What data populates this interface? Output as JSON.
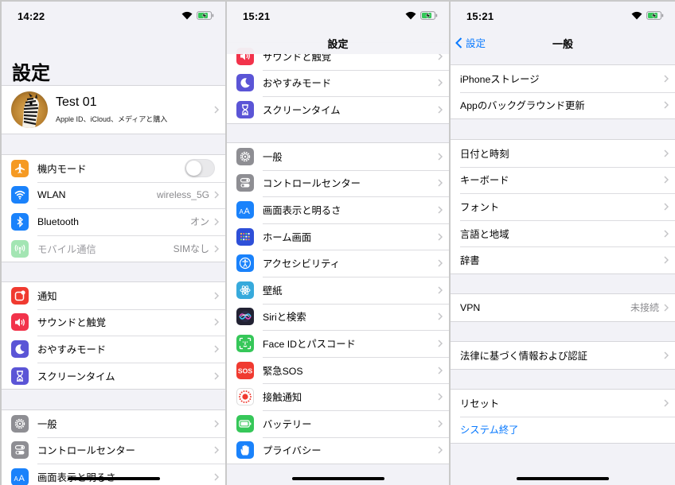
{
  "colors": {
    "accent": "#0a7aff",
    "background": "#f2f2f7"
  },
  "screen1": {
    "time": "14:22",
    "title": "設定",
    "profile": {
      "name": "Test 01",
      "subtitle": "Apple ID、iCloud、メディアと購入"
    },
    "group_connectivity": [
      {
        "label": "機内モード",
        "icon": "airplane-icon",
        "color": "#f59a23",
        "toggle": "off"
      },
      {
        "label": "WLAN",
        "icon": "wifi-icon",
        "color": "#1a82fb",
        "value": "wireless_5G"
      },
      {
        "label": "Bluetooth",
        "icon": "bluetooth-icon",
        "color": "#1a82fb",
        "value": "オン"
      },
      {
        "label": "モバイル通信",
        "icon": "antenna-icon",
        "color": "#36c759",
        "value": "SIMなし",
        "disabled": true
      }
    ],
    "group_notify": [
      {
        "label": "通知",
        "icon": "notification-icon",
        "color": "#f03a30"
      },
      {
        "label": "サウンドと触覚",
        "icon": "sound-icon",
        "color": "#f2334b"
      },
      {
        "label": "おやすみモード",
        "icon": "moon-icon",
        "color": "#5b55d6"
      },
      {
        "label": "スクリーンタイム",
        "icon": "hourglass-icon",
        "color": "#5b55d6"
      }
    ],
    "group_general": [
      {
        "label": "一般",
        "icon": "gear-icon",
        "color": "#8e8e93"
      },
      {
        "label": "コントロールセンター",
        "icon": "switches-icon",
        "color": "#8e8e93"
      },
      {
        "label": "画面表示と明るさ",
        "icon": "text-size-icon",
        "color": "#1a82fb"
      }
    ]
  },
  "screen2": {
    "time": "15:21",
    "nav_title": "設定",
    "group_top": [
      {
        "label": "サウンドと触覚",
        "icon": "sound-icon",
        "color": "#f2334b"
      },
      {
        "label": "おやすみモード",
        "icon": "moon-icon",
        "color": "#5b55d6"
      },
      {
        "label": "スクリーンタイム",
        "icon": "hourglass-icon",
        "color": "#5b55d6"
      }
    ],
    "group_main": [
      {
        "label": "一般",
        "icon": "gear-icon",
        "color": "#8e8e93"
      },
      {
        "label": "コントロールセンター",
        "icon": "switches-icon",
        "color": "#8e8e93"
      },
      {
        "label": "画面表示と明るさ",
        "icon": "text-size-icon",
        "color": "#1a82fb"
      },
      {
        "label": "ホーム画面",
        "icon": "home-grid-icon",
        "color": "#2e4fd8"
      },
      {
        "label": "アクセシビリティ",
        "icon": "accessibility-icon",
        "color": "#1a82fb"
      },
      {
        "label": "壁紙",
        "icon": "flower-icon",
        "color": "#37aadc"
      },
      {
        "label": "Siriと検索",
        "icon": "siri-icon",
        "color": "#222233"
      },
      {
        "label": "Face IDとパスコード",
        "icon": "faceid-icon",
        "color": "#36c759"
      },
      {
        "label": "緊急SOS",
        "icon": "sos-icon",
        "color": "#f03a30"
      },
      {
        "label": "接触通知",
        "icon": "exposure-icon",
        "color": "#ffffff"
      },
      {
        "label": "バッテリー",
        "icon": "battery-icon",
        "color": "#36c759"
      },
      {
        "label": "プライバシー",
        "icon": "hand-icon",
        "color": "#1a82fb"
      }
    ]
  },
  "screen3": {
    "time": "15:21",
    "back_label": "設定",
    "nav_title": "一般",
    "group_a": [
      {
        "label": "iPhoneストレージ"
      },
      {
        "label": "Appのバックグラウンド更新"
      }
    ],
    "group_b": [
      {
        "label": "日付と時刻"
      },
      {
        "label": "キーボード"
      },
      {
        "label": "フォント"
      },
      {
        "label": "言語と地域"
      },
      {
        "label": "辞書"
      }
    ],
    "group_c": [
      {
        "label": "VPN",
        "value": "未接続"
      }
    ],
    "group_d": [
      {
        "label": "法律に基づく情報および認証"
      }
    ],
    "group_e": [
      {
        "label": "リセット"
      },
      {
        "label": "システム終了",
        "link": true
      }
    ]
  }
}
